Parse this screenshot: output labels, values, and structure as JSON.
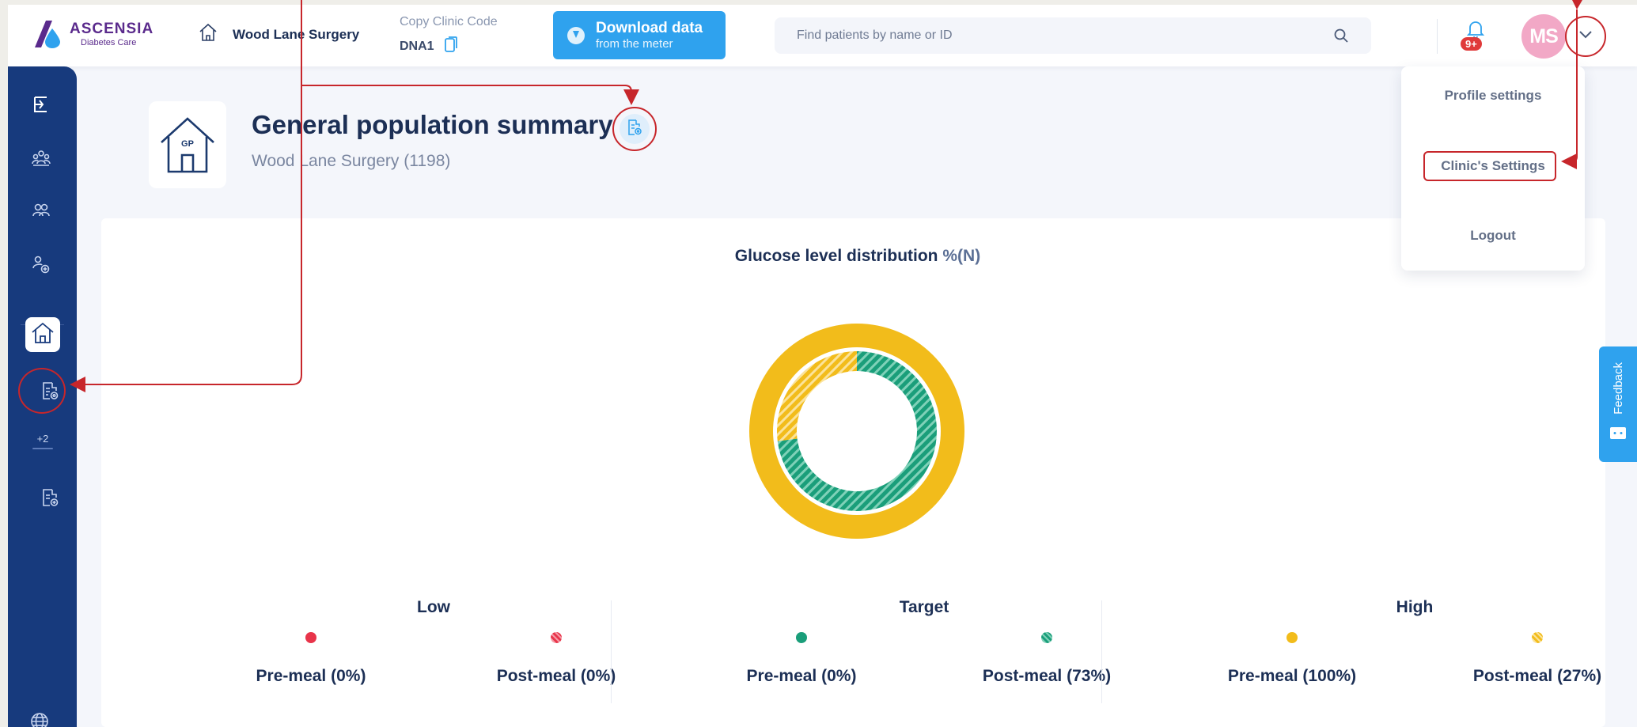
{
  "brand": {
    "name": "ASCENSIA",
    "tagline": "Diabetes Care"
  },
  "header": {
    "clinic_name": "Wood Lane Surgery",
    "copy_code_label": "Copy Clinic Code",
    "clinic_code": "DNA1",
    "download_title": "Download data",
    "download_subtitle": "from the meter",
    "search_placeholder": "Find patients by name or ID",
    "notification_count": "9+",
    "avatar_initials": "MS"
  },
  "sidebar": {
    "more_count": "+2"
  },
  "page": {
    "gp_label": "GP",
    "title": "General population summary",
    "subtitle": "Wood Lane Surgery (1198)"
  },
  "chart": {
    "title": "Glucose level distribution",
    "unit_label": "%(N)"
  },
  "chart_data": {
    "type": "pie",
    "title": "Glucose level distribution %(N)",
    "rings": [
      {
        "name": "Pre-meal",
        "slices": [
          {
            "label": "Low",
            "percent": 0,
            "color": "#e8344a"
          },
          {
            "label": "Target",
            "percent": 0,
            "color": "#1a9e7a"
          },
          {
            "label": "High",
            "percent": 100,
            "color": "#f2bc1b"
          }
        ]
      },
      {
        "name": "Post-meal",
        "slices": [
          {
            "label": "Low",
            "percent": 0,
            "color": "#e8344a"
          },
          {
            "label": "Target",
            "percent": 73,
            "color": "#1a9e7a"
          },
          {
            "label": "High",
            "percent": 27,
            "color": "#f2bc1b"
          }
        ]
      }
    ]
  },
  "groups": [
    {
      "title": "Low",
      "color": "#e8344a",
      "pre": "Pre-meal (0%)",
      "post": "Post-meal (0%)"
    },
    {
      "title": "Target",
      "color": "#1a9e7a",
      "pre": "Pre-meal (0%)",
      "post": "Post-meal (73%)"
    },
    {
      "title": "High",
      "color": "#f2bc1b",
      "pre": "Pre-meal (100%)",
      "post": "Post-meal (27%)"
    }
  ],
  "profile_menu": {
    "items": [
      "Profile settings",
      "Clinic's Settings",
      "Logout"
    ]
  },
  "feedback_label": "Feedback",
  "colors": {
    "sidebar": "#173a7d",
    "accent": "#2fa2ee",
    "annotation": "#c7262b"
  }
}
